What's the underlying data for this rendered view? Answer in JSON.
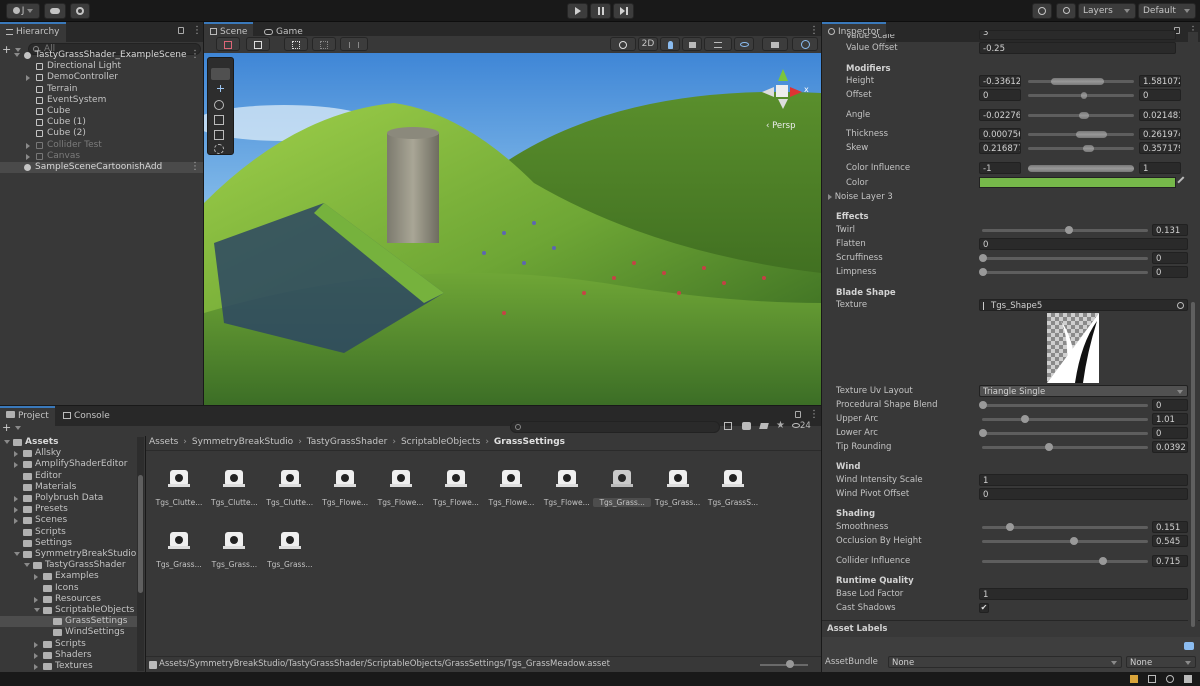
{
  "toolbar": {
    "account_label": "J",
    "layers_label": "Layers",
    "layout_label": "Default"
  },
  "hierarchy": {
    "tab": "Hierarchy",
    "search_placeholder": "All",
    "items": [
      {
        "label": "TastyGrassShader_ExampleScene",
        "kind": "scene"
      },
      {
        "label": "Directional Light",
        "kind": "obj"
      },
      {
        "label": "DemoController",
        "kind": "obj"
      },
      {
        "label": "Terrain",
        "kind": "obj"
      },
      {
        "label": "EventSystem",
        "kind": "obj"
      },
      {
        "label": "Cube",
        "kind": "obj"
      },
      {
        "label": "Cube (1)",
        "kind": "obj"
      },
      {
        "label": "Cube (2)",
        "kind": "obj"
      },
      {
        "label": "Collider Test",
        "kind": "dim"
      },
      {
        "label": "Canvas",
        "kind": "dim"
      },
      {
        "label": "SampleSceneCartoonishAdd",
        "kind": "scene"
      }
    ]
  },
  "scene": {
    "tab_scene": "Scene",
    "tab_game": "Game",
    "mode_2d": "2D",
    "persp_label": "‹ Persp",
    "gizmo_x": "x"
  },
  "project": {
    "tab_project": "Project",
    "tab_console": "Console",
    "badge_count": "24",
    "breadcrumb": [
      "Assets",
      "SymmetryBreakStudio",
      "TastyGrassShader",
      "ScriptableObjects",
      "GrassSettings"
    ],
    "tree": [
      {
        "label": "Assets",
        "bold": true
      },
      {
        "label": "Allsky"
      },
      {
        "label": "AmplifyShaderEditor"
      },
      {
        "label": "Editor"
      },
      {
        "label": "Materials"
      },
      {
        "label": "Polybrush Data"
      },
      {
        "label": "Presets"
      },
      {
        "label": "Scenes"
      },
      {
        "label": "Scripts"
      },
      {
        "label": "Settings"
      },
      {
        "label": "SymmetryBreakStudio"
      },
      {
        "label": "TastyGrassShader"
      },
      {
        "label": "Examples"
      },
      {
        "label": "Icons"
      },
      {
        "label": "Resources"
      },
      {
        "label": "ScriptableObjects"
      },
      {
        "label": "GrassSettings"
      },
      {
        "label": "WindSettings"
      },
      {
        "label": "Scripts"
      },
      {
        "label": "Shaders"
      },
      {
        "label": "Textures"
      }
    ],
    "assets": [
      "Tgs_Clutte...",
      "Tgs_Clutte...",
      "Tgs_Clutte...",
      "Tgs_Flowe...",
      "Tgs_Flowe...",
      "Tgs_Flowe...",
      "Tgs_Flowe...",
      "Tgs_Flowe...",
      "Tgs_Grass...",
      "Tgs_Grass...",
      "Tgs_GrassS...",
      "Tgs_Grass...",
      "Tgs_Grass...",
      "Tgs_Grass..."
    ],
    "status_path": "Assets/SymmetryBreakStudio/TastyGrassShader/ScriptableObjects/GrassSettings/Tgs_GrassMeadow.asset"
  },
  "inspector": {
    "tab": "Inspector",
    "value_scale_label": "Value Scale",
    "value_scale": "3",
    "value_offset_label": "Value Offset",
    "value_offset": "-0.25",
    "modifiers_header": "Modifiers",
    "modifiers": [
      {
        "label": "Height",
        "min": "-0.33612",
        "max": "1.581072"
      },
      {
        "label": "Offset",
        "min": "0",
        "max": "0"
      },
      {
        "label": "Angle",
        "min": "-0.02276",
        "max": "0.021481"
      },
      {
        "label": "Thickness",
        "min": "0.000756",
        "max": "0.261974"
      },
      {
        "label": "Skew",
        "min": "0.216877",
        "max": "0.357179"
      },
      {
        "label": "Color Influence",
        "min": "-1",
        "max": "1"
      }
    ],
    "color_label": "Color",
    "color_value": "#76b84a",
    "noise_layer": "Noise Layer 3",
    "effects_header": "Effects",
    "effects": [
      {
        "label": "Twirl",
        "value": "0.131",
        "pos": 0.52
      },
      {
        "label": "Flatten",
        "value": "0",
        "pos": null
      },
      {
        "label": "Scruffiness",
        "value": "0",
        "pos": 0.0
      },
      {
        "label": "Limpness",
        "value": "0",
        "pos": 0.0
      }
    ],
    "blade_header": "Blade Shape",
    "texture_label": "Texture",
    "texture_value": "Tgs_Shape5",
    "uv_layout_label": "Texture Uv Layout",
    "uv_layout_value": "Triangle Single",
    "blade": [
      {
        "label": "Procedural Shape Blend",
        "value": "0",
        "pos": 0.0
      },
      {
        "label": "Upper Arc",
        "value": "1.01",
        "pos": 0.25
      },
      {
        "label": "Lower Arc",
        "value": "0",
        "pos": 0.0
      },
      {
        "label": "Tip Rounding",
        "value": "0.0392",
        "pos": 0.4
      }
    ],
    "wind_header": "Wind",
    "wind": [
      {
        "label": "Wind Intensity Scale",
        "value": "1"
      },
      {
        "label": "Wind Pivot Offset",
        "value": "0"
      }
    ],
    "shading_header": "Shading",
    "shading": [
      {
        "label": "Smoothness",
        "value": "0.151",
        "pos": 0.16
      },
      {
        "label": "Occlusion By Height",
        "value": "0.545",
        "pos": 0.55
      },
      {
        "label": "Collider Influence",
        "value": "0.715",
        "pos": 0.72
      }
    ],
    "runtime_header": "Runtime Quality",
    "base_lod_label": "Base Lod Factor",
    "base_lod_value": "1",
    "cast_shadows_label": "Cast Shadows",
    "cast_shadows_check": "✔",
    "asset_labels": "Asset Labels",
    "asset_bundle_label": "AssetBundle",
    "asset_bundle_value": "None",
    "asset_variant_value": "None"
  }
}
